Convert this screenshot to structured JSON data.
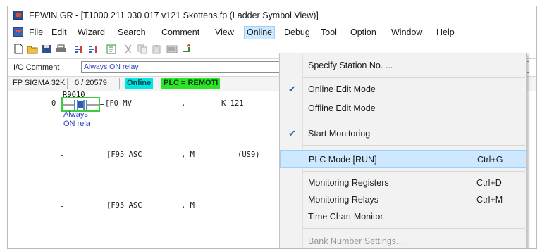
{
  "window": {
    "title": "FPWIN GR - [T1000 211 030 017 v121 Skottens.fp (Ladder Symbol View)]"
  },
  "menubar": {
    "items": [
      "File",
      "Edit",
      "Wizard",
      "Search",
      "Comment",
      "View",
      "Online",
      "Debug",
      "Tool",
      "Option",
      "Window",
      "Help"
    ],
    "active": "Online"
  },
  "toolbar": {
    "icons": [
      "new-file-icon",
      "open-folder-icon",
      "save-icon",
      "print-icon",
      "cross-ref-icon",
      "cross-ref-alt-icon",
      "monitor-icon",
      "cut-icon",
      "copy-icon",
      "paste-icon",
      "register-icon",
      "transfer-icon"
    ]
  },
  "comment_bar": {
    "label": "I/O Comment",
    "value": "Always ON relay"
  },
  "status_bar": {
    "plc_type": "FP SIGMA 32K",
    "steps": "0 / 20579",
    "online": "Online",
    "plc_mode": "PLC = REMOTI",
    "colors": {
      "online_bg": "#00e5e5",
      "plc_bg": "#29e629"
    }
  },
  "ladder": {
    "contact_label": "R9010",
    "row_number": "0",
    "contact_comment_line1": "Always",
    "contact_comment_line2": "ON rela",
    "rungs": [
      {
        "instr": "[F0 MV",
        "sep": ",",
        "operand": "K 121"
      },
      {
        "instr": "[F95 ASC",
        "sep": ", M",
        "operand": "(US9)"
      },
      {
        "instr": "[F95 ASC",
        "sep": ", M",
        "operand": ""
      }
    ],
    "colors": {
      "comment": "#2a3fbf",
      "selection": "#3ccd3c"
    }
  },
  "online_menu": {
    "items": [
      {
        "label": "Specify Station No. ...",
        "shortcut": "",
        "checked": false,
        "highlight": false,
        "disabled": false
      },
      {
        "label": "Online Edit Mode",
        "shortcut": "",
        "checked": true,
        "highlight": false,
        "disabled": false
      },
      {
        "label": "Offline Edit Mode",
        "shortcut": "",
        "checked": false,
        "highlight": false,
        "disabled": false
      },
      {
        "label": "Start Monitoring",
        "shortcut": "",
        "checked": true,
        "highlight": false,
        "disabled": false
      },
      {
        "label": "PLC Mode [RUN]",
        "shortcut": "Ctrl+G",
        "checked": false,
        "highlight": true,
        "disabled": false
      },
      {
        "label": "Monitoring Registers",
        "shortcut": "Ctrl+D",
        "checked": false,
        "highlight": false,
        "disabled": false
      },
      {
        "label": "Monitoring Relays",
        "shortcut": "Ctrl+M",
        "checked": false,
        "highlight": false,
        "disabled": false
      },
      {
        "label": "Time Chart Monitor",
        "shortcut": "",
        "checked": false,
        "highlight": false,
        "disabled": false
      },
      {
        "label": "Bank Number Settings...",
        "shortcut": "",
        "checked": false,
        "highlight": false,
        "disabled": true
      }
    ],
    "check_glyph": "✔",
    "highlight_color": "#cde8ff"
  }
}
